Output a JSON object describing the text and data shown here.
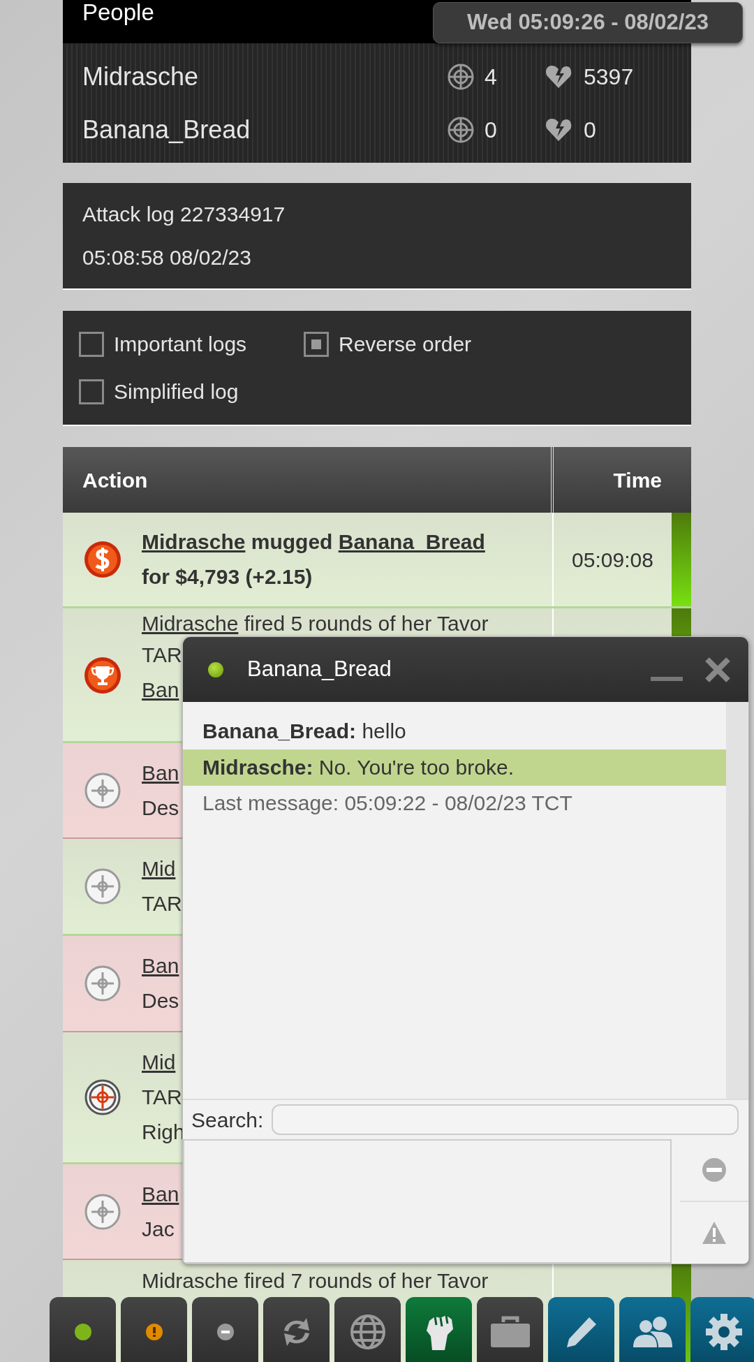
{
  "people": {
    "title": "People",
    "rows": [
      {
        "name": "Midrasche",
        "attacks": "4",
        "losses": "5397"
      },
      {
        "name": "Banana_Bread",
        "attacks": "0",
        "losses": "0"
      }
    ]
  },
  "clock": "Wed 05:09:26 - 08/02/23",
  "attack_log": {
    "title": "Attack log 227334917",
    "time": "05:08:58 08/02/23"
  },
  "options": [
    {
      "label": "Important logs",
      "checked": false
    },
    {
      "label": "Reverse order",
      "checked": true
    },
    {
      "label": "Simplified log",
      "checked": false
    }
  ],
  "table": {
    "columns": [
      "Action",
      "Time"
    ],
    "rows": [
      {
        "kind": "mug",
        "won": true,
        "time": "05:09:08",
        "lines": [
          [
            {
              "text": "Midrasche",
              "link": true
            },
            {
              "text": " mugged ",
              "link": false
            },
            {
              "text": "Banana_Bread",
              "link": true
            },
            {
              "text": " for $4,793 (+2.15)",
              "link": false
            }
          ]
        ]
      },
      {
        "kind": "trophy",
        "won": true,
        "lines": [
          [
            {
              "text": "Midrasche",
              "link": true
            },
            {
              "text": " fired 5 rounds of her Tavor",
              "link": false
            }
          ],
          [
            {
              "text": "TAR",
              "link": false
            }
          ],
          [
            {
              "text": "Ban",
              "link": true
            }
          ]
        ]
      },
      {
        "kind": "miss",
        "won": false,
        "lines": [
          [
            {
              "text": "Ban",
              "link": true
            }
          ],
          [
            {
              "text": "Des",
              "link": false
            }
          ]
        ]
      },
      {
        "kind": "miss",
        "won": true,
        "lines": [
          [
            {
              "text": "Mid",
              "link": true
            }
          ],
          [
            {
              "text": "TAR",
              "link": false
            }
          ]
        ]
      },
      {
        "kind": "miss",
        "won": false,
        "lines": [
          [
            {
              "text": "Ban",
              "link": true
            }
          ],
          [
            {
              "text": "Des",
              "link": false
            }
          ]
        ]
      },
      {
        "kind": "hit",
        "won": true,
        "lines": [
          [
            {
              "text": "Mid",
              "link": true
            }
          ],
          [
            {
              "text": "TAR",
              "link": false
            }
          ],
          [
            {
              "text": "Righ",
              "link": false
            }
          ]
        ]
      },
      {
        "kind": "miss",
        "won": false,
        "lines": [
          [
            {
              "text": "Ban",
              "link": true
            }
          ],
          [
            {
              "text": "Jac",
              "link": false
            }
          ]
        ]
      },
      {
        "kind": "hidden",
        "won": true,
        "lines": [
          [
            {
              "text": "Midrasche fired 7 rounds of her Tavor",
              "link": false
            }
          ]
        ]
      }
    ]
  },
  "chat": {
    "title": "Banana_Bread",
    "online": true,
    "messages": [
      {
        "sender": "Banana_Bread:",
        "text": "hello",
        "highlighted": false
      },
      {
        "sender": "Midrasche:",
        "text": "No. You're too broke.",
        "highlighted": true
      }
    ],
    "info": "Last message: 05:09:22 - 08/02/23 TCT",
    "search_label": "Search:"
  },
  "toolbar": [
    {
      "kind": "status",
      "color": "#7fb31a"
    },
    {
      "kind": "status-alert",
      "color": "#e08a00"
    },
    {
      "kind": "status-minus",
      "color": "#9a9a9a"
    },
    {
      "kind": "refresh"
    },
    {
      "kind": "globe"
    },
    {
      "kind": "fist"
    },
    {
      "kind": "briefcase"
    },
    {
      "kind": "pencil"
    },
    {
      "kind": "people"
    },
    {
      "kind": "gear"
    }
  ]
}
